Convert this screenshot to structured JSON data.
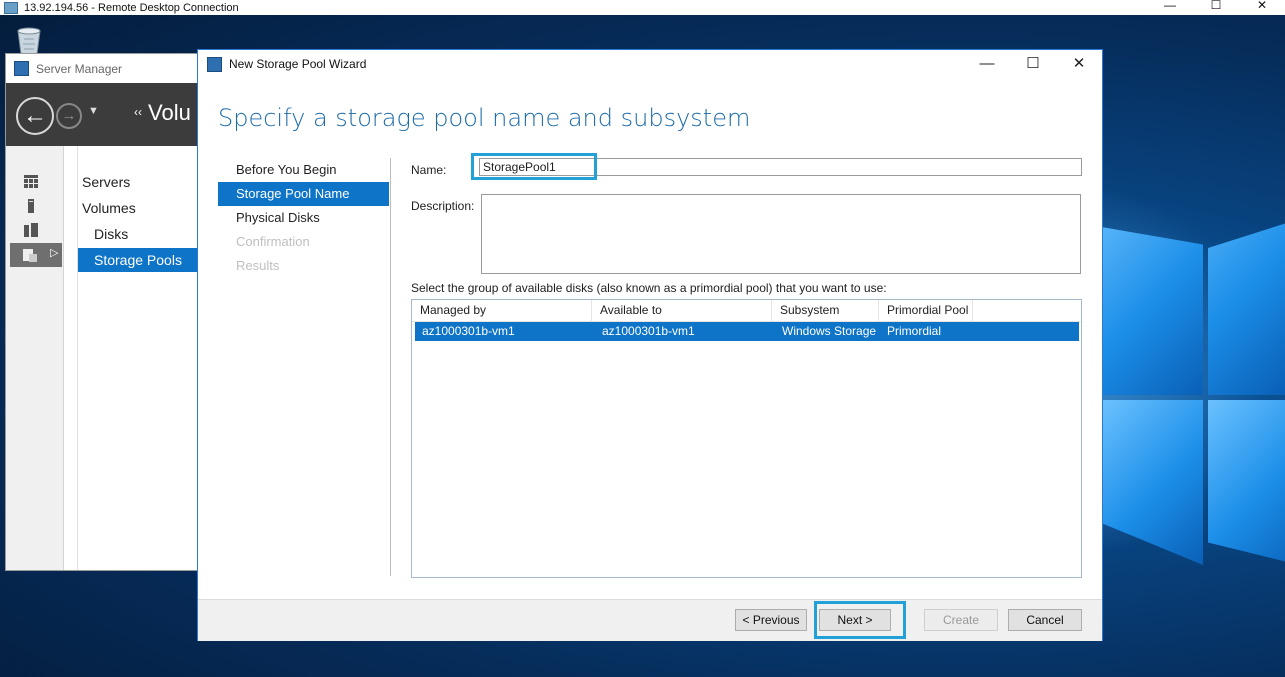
{
  "rdp": {
    "title": "13.92.194.56 - Remote Desktop Connection",
    "minimize": "—",
    "maximize": "☐",
    "close": "✕"
  },
  "server_manager": {
    "title": "Server Manager",
    "breadcrumb_arrows": "‹‹",
    "breadcrumb": "Volu",
    "back_glyph": "←",
    "forward_glyph": "→",
    "dropdown_glyph": "▼",
    "nav": {
      "servers": "Servers",
      "volumes": "Volumes",
      "disks": "Disks",
      "storage_pools": "Storage Pools"
    },
    "rail_icons": [
      "dashboard-icon",
      "local-server-icon",
      "all-servers-icon",
      "file-storage-icon"
    ]
  },
  "wizard": {
    "title": "New Storage Pool Wizard",
    "controls": {
      "minimize": "—",
      "maximize": "☐",
      "close": "✕"
    },
    "heading": "Specify a storage pool name and subsystem",
    "steps": [
      {
        "label": "Before You Begin",
        "state": "normal"
      },
      {
        "label": "Storage Pool Name",
        "state": "selected"
      },
      {
        "label": "Physical Disks",
        "state": "normal"
      },
      {
        "label": "Confirmation",
        "state": "disabled"
      },
      {
        "label": "Results",
        "state": "disabled"
      }
    ],
    "name_label": "Name:",
    "name_value": "StoragePool1",
    "description_label": "Description:",
    "description_value": "",
    "select_prompt": "Select the group of available disks (also known as a primordial pool) that you want to use:",
    "grid": {
      "columns": [
        "Managed by",
        "Available to",
        "Subsystem",
        "Primordial Pool"
      ],
      "rows": [
        [
          "az1000301b-vm1",
          "az1000301b-vm1",
          "Windows Storage",
          "Primordial"
        ]
      ]
    },
    "buttons": {
      "previous": "< Previous",
      "next": "Next >",
      "create": "Create",
      "cancel": "Cancel"
    }
  },
  "colors": {
    "accent": "#0e74c7",
    "highlight_box": "#22a0d8",
    "heading": "#1b6aa8",
    "toolbar_dark": "#3c3c3c"
  }
}
